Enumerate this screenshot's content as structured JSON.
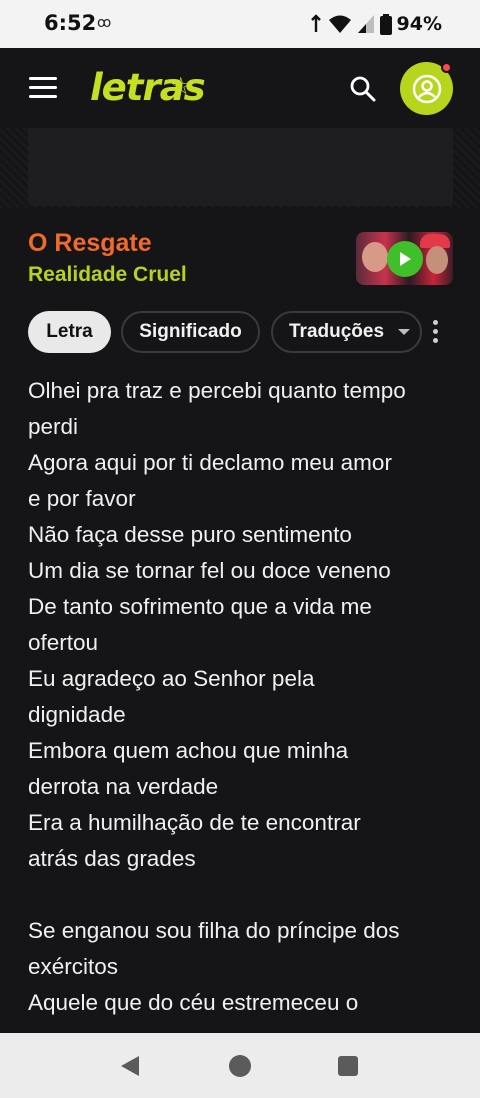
{
  "status_bar": {
    "time": "6:52",
    "notification_icon": "ꝏ",
    "battery_percent": "94%"
  },
  "header": {
    "logo_text": "letras",
    "logo_star": "☆",
    "brand_color": "#c6e020"
  },
  "song": {
    "title": "O Resgate",
    "artist": "Realidade Cruel",
    "title_color": "#f26a2a",
    "artist_color": "#b6d21f"
  },
  "tabs": [
    {
      "label": "Letra",
      "active": true
    },
    {
      "label": "Significado",
      "active": false
    },
    {
      "label": "Traduções",
      "active": false
    }
  ],
  "lyrics": [
    "Olhei pra traz e percebi quanto tempo",
    "perdi",
    "Agora aqui por ti declamo meu amor",
    "e por favor",
    "Não faça desse puro sentimento",
    "Um dia se tornar fel ou doce veneno",
    "De tanto sofrimento que a vida me",
    "ofertou",
    "Eu agradeço ao Senhor pela",
    "dignidade",
    "Embora quem achou que minha",
    "derrota na verdade",
    "Era a humilhação de te encontrar",
    "atrás das grades",
    "",
    "Se enganou sou filha do príncipe dos",
    "exércitos",
    "Aquele que do céu estremeceu o"
  ]
}
